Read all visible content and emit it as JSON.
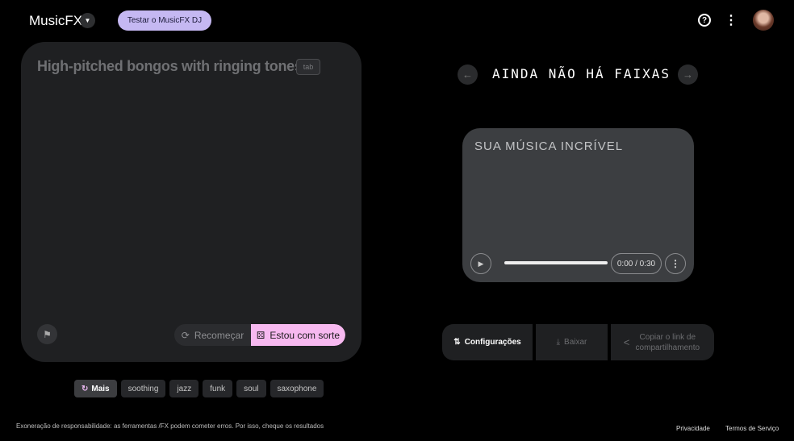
{
  "header": {
    "app_name": "MusicFX",
    "dj_button": "Testar o MusicFX DJ",
    "help_icon": "?",
    "more_icon": "⋮"
  },
  "prompt": {
    "text": "High-pitched bongos with ringing tones",
    "tab_hint": "tab",
    "restart_label": "Recomeçar",
    "lucky_label": "Estou com sorte"
  },
  "chips": {
    "more_label": "Mais",
    "items": [
      "soothing",
      "jazz",
      "funk",
      "soul",
      "saxophone"
    ]
  },
  "tracks": {
    "title": "AINDA NÃO HÁ FAIXAS"
  },
  "player": {
    "title": "SUA MÚSICA INCRÍVEL",
    "time": "0:00 / 0:30",
    "progress": 0
  },
  "actions": {
    "settings": "Configurações",
    "download": "Baixar",
    "share": "Copiar o link de compartilhamento"
  },
  "footer": {
    "disclaimer": "Exoneração de responsabilidade: as ferramentas /FX podem cometer erros. Por isso, cheque os resultados",
    "privacy": "Privacidade",
    "terms": "Termos de Serviço"
  }
}
